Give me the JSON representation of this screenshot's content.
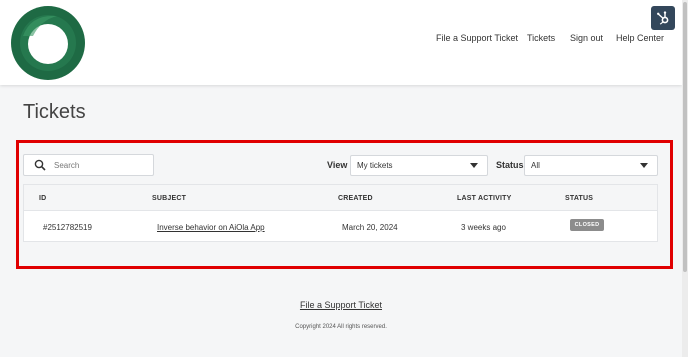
{
  "header": {
    "nav": [
      {
        "label": "File a Support Ticket"
      },
      {
        "label": "Tickets"
      },
      {
        "label": "Sign out"
      },
      {
        "label": "Help Center"
      }
    ]
  },
  "page": {
    "title": "Tickets"
  },
  "filters": {
    "search_placeholder": "Search",
    "view_label": "View",
    "view_value": "My tickets",
    "status_label": "Status",
    "status_value": "All"
  },
  "table": {
    "columns": [
      "ID",
      "SUBJECT",
      "CREATED",
      "LAST ACTIVITY",
      "STATUS"
    ],
    "rows": [
      {
        "id": "#2512782519",
        "subject": "Inverse behavior on AiOla App",
        "created": "March 20, 2024",
        "last_activity": "3 weeks ago",
        "status": "CLOSED"
      }
    ]
  },
  "footer": {
    "link": "File a Support Ticket",
    "copyright": "Copyright 2024 All rights reserved."
  },
  "colors": {
    "logo": "#1e6a44",
    "highlight": "#e00000",
    "badge": "#8c8c8c",
    "hub_button": "#33475b"
  },
  "icons": [
    "logo-ring",
    "search-icon",
    "hubspot-icon",
    "chevron-down-icon"
  ]
}
